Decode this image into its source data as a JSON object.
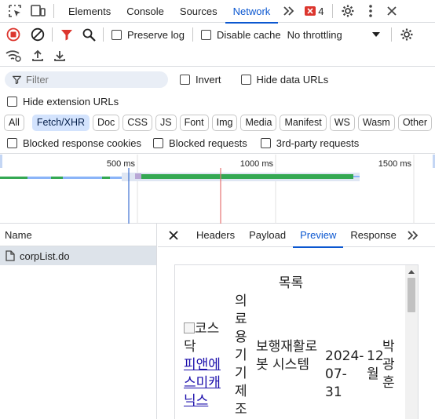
{
  "top_tabs": [
    "Elements",
    "Console",
    "Sources",
    "Network"
  ],
  "active_top_tab": "Network",
  "issues_count": "4",
  "toolbar": {
    "preserve_log": "Preserve log",
    "disable_cache": "Disable cache",
    "throttling": "No throttling"
  },
  "filter": {
    "placeholder": "Filter",
    "invert": "Invert",
    "hide_data_urls": "Hide data URLs",
    "hide_extension_urls": "Hide extension URLs"
  },
  "type_filters": [
    "All",
    "Fetch/XHR",
    "Doc",
    "CSS",
    "JS",
    "Font",
    "Img",
    "Media",
    "Manifest",
    "WS",
    "Wasm",
    "Other"
  ],
  "active_type_filter": "Fetch/XHR",
  "blocked": {
    "blocked_cookies": "Blocked response cookies",
    "blocked_requests": "Blocked requests",
    "third_party": "3rd-party requests"
  },
  "timeline": {
    "ticks": [
      "500 ms",
      "1000 ms",
      "1500 ms"
    ]
  },
  "requests": {
    "column": "Name",
    "items": [
      "corpList.do"
    ]
  },
  "detail_tabs": [
    "Headers",
    "Payload",
    "Preview",
    "Response"
  ],
  "active_detail_tab": "Preview",
  "preview": {
    "title": "목록",
    "image_alt": "코스닥",
    "link": "피앤에스미캐닉스",
    "industry": "의료용기기제조",
    "product": "보행재활로봇 시스템",
    "date": "2024-07-31",
    "month": "12월",
    "person": "박광훈"
  },
  "colors": {
    "accent": "#0b57d0",
    "record": "#dc362e",
    "bar_green": "#34a853"
  }
}
